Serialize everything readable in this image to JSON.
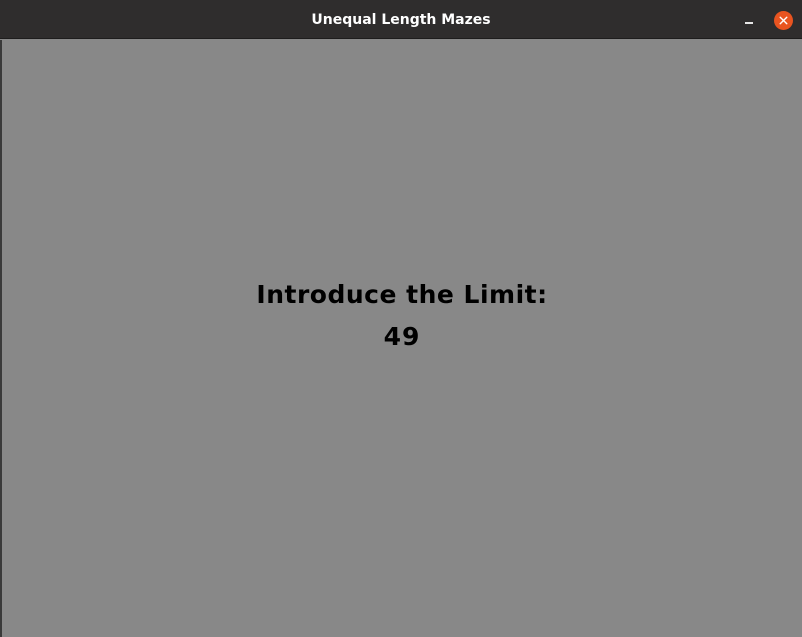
{
  "window": {
    "title": "Unequal Length Mazes",
    "minimize_icon": "minimize-icon",
    "close_icon": "close-icon",
    "close_color": "#e95420",
    "background_color": "#888888"
  },
  "main": {
    "prompt": "Introduce the Limit:",
    "value": "49"
  }
}
